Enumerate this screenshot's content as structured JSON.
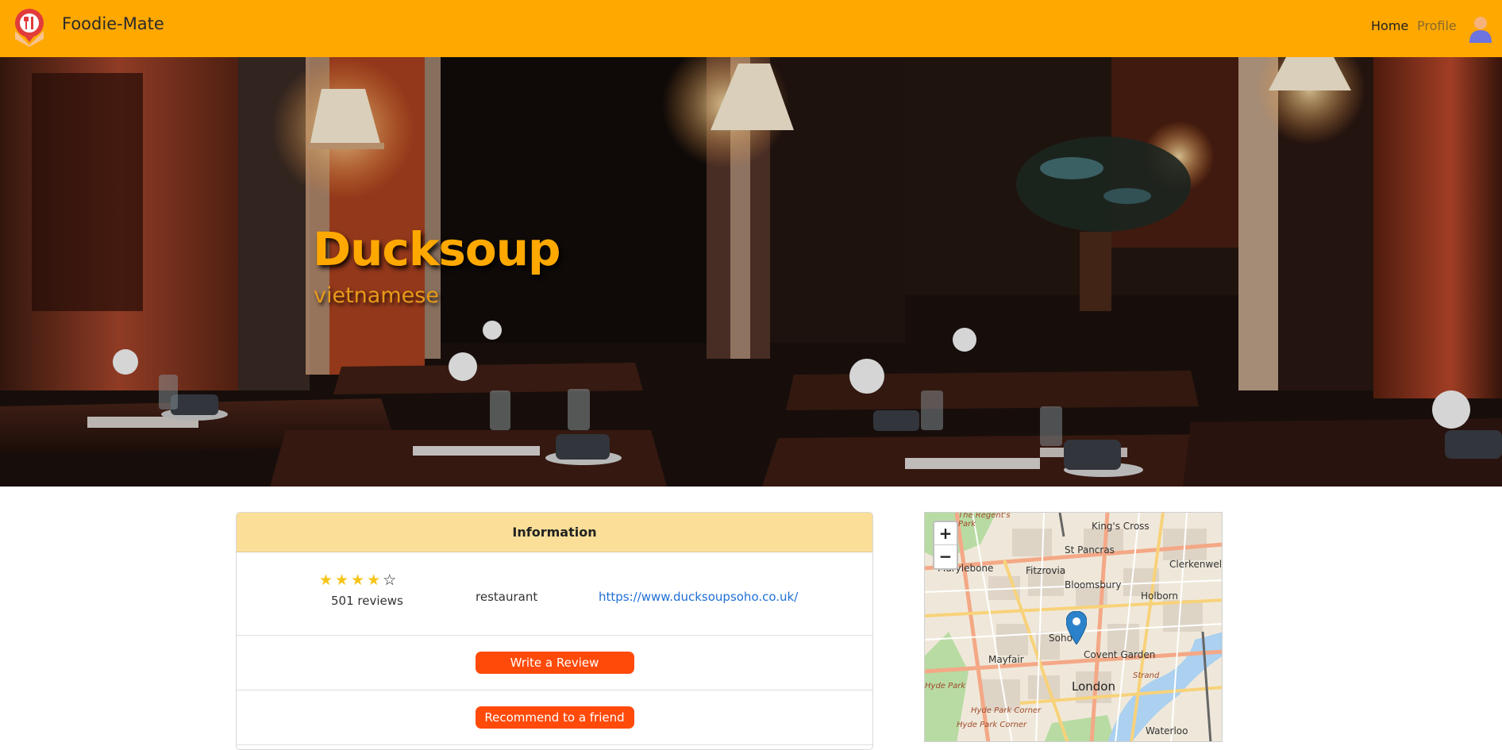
{
  "navbar": {
    "brand": "Foodie-Mate",
    "home_label": "Home",
    "profile_label": "Profile",
    "color": "#FFA800"
  },
  "hero": {
    "title": "Ducksoup",
    "subtitle": "vietnamese"
  },
  "info": {
    "header": "Information",
    "rating": 4,
    "rating_max": 5,
    "reviews": "501 reviews",
    "category": "restaurant",
    "website": "https://www.ducksoupsoho.co.uk/"
  },
  "actions": {
    "write_review": "Write a Review",
    "recommend": "Recommend to a friend",
    "button_color": "#FF4A0A"
  },
  "map": {
    "zoom_in": "+",
    "zoom_out": "−",
    "labels": {
      "regents_park": "The Regent's\nPark",
      "kings_cross": "King's Cross",
      "st_pancras": "St Pancras",
      "clerkenwell": "Clerkenwell",
      "marylebone": "Marylebone",
      "fitzrovia": "Fitzrovia",
      "bloomsbury": "Bloomsbury",
      "holborn": "Holborn",
      "soho": "Soho",
      "covent_garden": "Covent Garden",
      "mayfair": "Mayfair",
      "london": "London",
      "hyde_park": "Hyde Park",
      "hyde_park_corner": "Hyde Park Corner",
      "hyde_park_corner2": "Hyde Park Corner",
      "strand": "Strand",
      "waterloo": "Waterloo"
    }
  }
}
